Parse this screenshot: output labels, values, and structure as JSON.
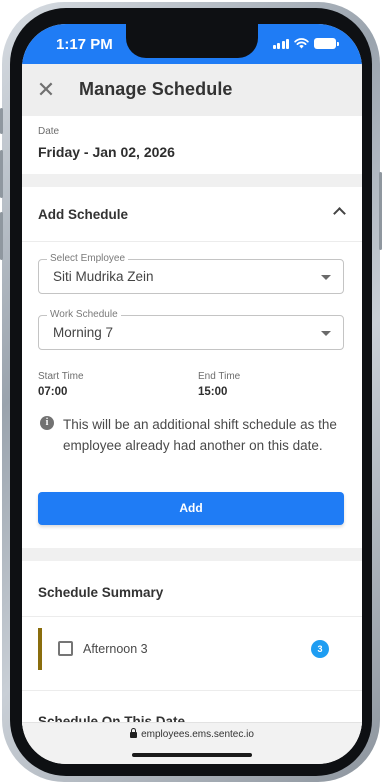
{
  "status_bar": {
    "time": "1:17 PM",
    "icons": [
      "signal-icon",
      "wifi-icon",
      "battery-icon"
    ]
  },
  "app_bar": {
    "close_icon": "close-icon",
    "title": "Manage Schedule"
  },
  "date_section": {
    "label": "Date",
    "value": "Friday - Jan 02, 2026"
  },
  "add_schedule": {
    "title": "Add Schedule",
    "toggle_icon": "chevron-up-icon",
    "employee_field": {
      "label": "Select Employee",
      "value": "Siti Mudrika Zein"
    },
    "work_schedule_field": {
      "label": "Work Schedule",
      "value": "Morning 7"
    },
    "start_time": {
      "label": "Start Time",
      "value": "07:00"
    },
    "end_time": {
      "label": "End Time",
      "value": "15:00"
    },
    "info_icon": "info-icon",
    "info_text": "This will be an additional shift schedule as the employee already had another on this date.",
    "add_button": "Add"
  },
  "schedule_summary": {
    "title": "Schedule Summary",
    "items": [
      {
        "label": "Afternoon 3",
        "count": "3",
        "accent_color": "#8a6d0d"
      }
    ]
  },
  "next_section": {
    "title": "Schedule On This Date"
  },
  "browser": {
    "url": "employees.ems.sentec.io",
    "lock_icon": "lock-icon"
  },
  "colors": {
    "primary": "#1f7cf5",
    "badge": "#1e9df2"
  }
}
